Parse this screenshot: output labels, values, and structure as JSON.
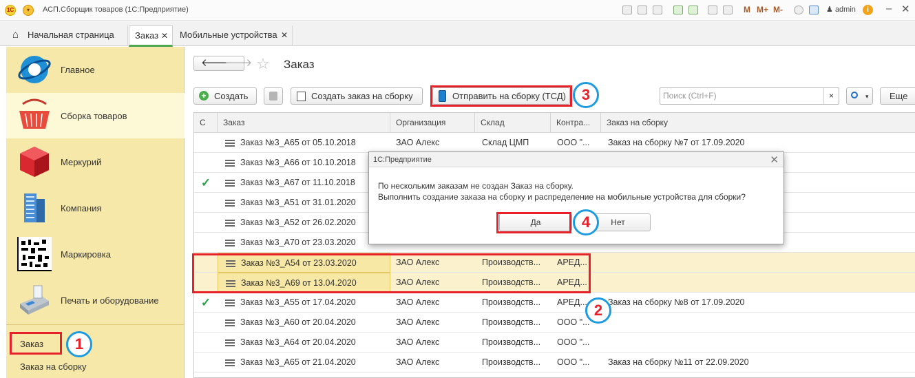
{
  "window": {
    "logo_text": "1С",
    "title": "АСП.Сборщик товаров (1С:Предприятие)",
    "menu_glyph": "▾",
    "user": "admin",
    "info_glyph": "i",
    "m": "M",
    "m_plus": "M+",
    "m_minus": "M-",
    "minimize": "–",
    "close": "✕"
  },
  "tabs": {
    "home": "Начальная страница",
    "active": "Заказ",
    "mobile": "Мобильные устройства",
    "close_glyph": "✕",
    "home_glyph": "⌂"
  },
  "sidebar": {
    "sections": [
      {
        "label": "Главное",
        "icon": "globe-icon"
      },
      {
        "label": "Сборка товаров",
        "icon": "shopping-basket-icon"
      },
      {
        "label": "Меркурий",
        "icon": "red-cube-icon"
      },
      {
        "label": "Компания",
        "icon": "building-icon"
      },
      {
        "label": "Маркировка",
        "icon": "datamatrix-code-icon"
      },
      {
        "label": "Печать и оборудование",
        "icon": "cash-register-icon"
      }
    ],
    "links": [
      "Заказ",
      "Заказ на сборку"
    ]
  },
  "page": {
    "title": "Заказ",
    "back_glyph": "🡐",
    "forward_glyph": "🡒",
    "star_glyph": "☆"
  },
  "toolbar": {
    "create": "Создать",
    "create_glyph": "+",
    "create_assembly_order": "Создать заказ на сборку",
    "send_to_assembly": "Отправить на сборку (ТСД)",
    "search_placeholder": "Поиск (Ctrl+F)",
    "search_clear": "×",
    "more": "Еще"
  },
  "table": {
    "columns": [
      "С",
      "Заказ",
      "Организация",
      "Склад",
      "Контра...",
      "Заказ на сборку"
    ],
    "rows": [
      {
        "check": "",
        "order": "Заказ №3_А65 от 05.10.2018",
        "org": "ЗАО Алекс",
        "warehouse": "Склад ЦМП",
        "contractor": "ООО \"...",
        "assembly": "Заказ на сборку №7 от 17.09.2020"
      },
      {
        "check": "",
        "order": "Заказ №3_А66 от 10.10.2018",
        "org": "",
        "warehouse": "",
        "contractor": "",
        "assembly": ""
      },
      {
        "check": "✓",
        "order": "Заказ №3_А67 от 11.10.2018",
        "org": "",
        "warehouse": "",
        "contractor": "",
        "assembly": ""
      },
      {
        "check": "",
        "order": "Заказ №3_А51 от 31.01.2020",
        "org": "",
        "warehouse": "",
        "contractor": "",
        "assembly": ""
      },
      {
        "check": "",
        "order": "Заказ №3_А52 от 26.02.2020",
        "org": "",
        "warehouse": "",
        "contractor": "",
        "assembly": ""
      },
      {
        "check": "",
        "order": "Заказ №3_А70 от 23.03.2020",
        "org": "",
        "warehouse": "",
        "contractor": "",
        "assembly": ""
      },
      {
        "check": "",
        "order": "Заказ №3_А54 от 23.03.2020",
        "org": "ЗАО Алекс",
        "warehouse": "Производств...",
        "contractor": "АРЕД...",
        "assembly": ""
      },
      {
        "check": "",
        "order": "Заказ №3_А69 от 13.04.2020",
        "org": "ЗАО Алекс",
        "warehouse": "Производств...",
        "contractor": "АРЕД...",
        "assembly": ""
      },
      {
        "check": "✓",
        "order": "Заказ №3_А55 от 17.04.2020",
        "org": "ЗАО Алекс",
        "warehouse": "Производств...",
        "contractor": "АРЕД...",
        "assembly": "Заказ на сборку №8 от 17.09.2020"
      },
      {
        "check": "",
        "order": "Заказ №3_А60 от 20.04.2020",
        "org": "ЗАО Алекс",
        "warehouse": "Производств...",
        "contractor": "ООО \"...",
        "assembly": ""
      },
      {
        "check": "",
        "order": "Заказ №3_А64 от 20.04.2020",
        "org": "ЗАО Алекс",
        "warehouse": "Производств...",
        "contractor": "ООО \"...",
        "assembly": ""
      },
      {
        "check": "",
        "order": "Заказ №3_А65 от 21.04.2020",
        "org": "ЗАО Алекс",
        "warehouse": "Производств...",
        "contractor": "ООО \"...",
        "assembly": "Заказ на сборку №11 от 22.09.2020"
      }
    ]
  },
  "dialog": {
    "title": "1С:Предприятие",
    "line1": "По нескольким заказам не создан Заказ на сборку.",
    "line2": "Выполнить создание заказа на сборку и распределение на мобильные устройства для сборки?",
    "yes": "Да",
    "no": "Нет",
    "close_glyph": "✕"
  },
  "callouts": [
    "1",
    "2",
    "3",
    "4"
  ],
  "colors": {
    "highlight_red": "#e8202a",
    "callout_blue": "#1d9be0",
    "sidebar_bg": "#f6e8a8",
    "check_green": "#2ea24b"
  }
}
